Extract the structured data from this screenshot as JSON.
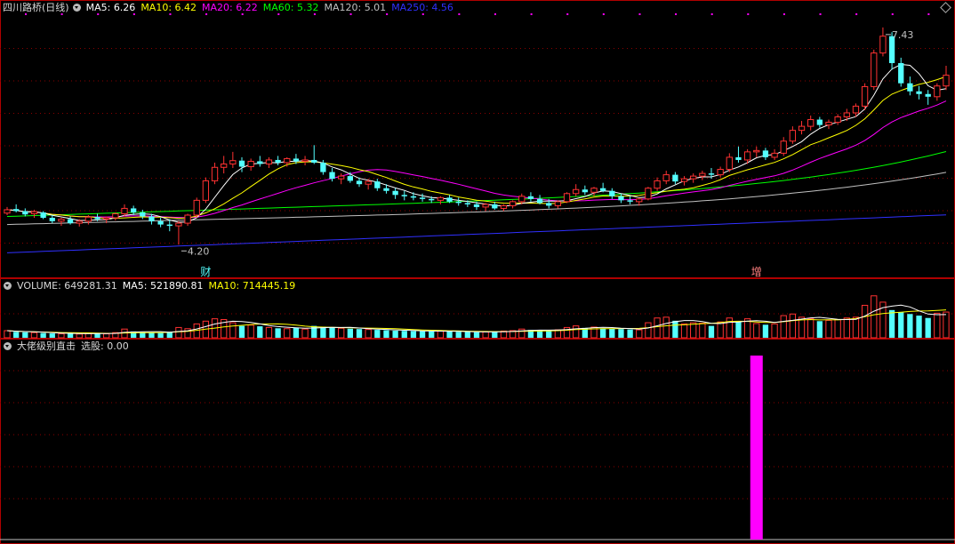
{
  "main": {
    "stock_name": "四川路桥(日线)",
    "ma_labels": [
      {
        "name": "MA5: ",
        "value": "6.26",
        "color": "#ffffff"
      },
      {
        "name": "MA10: ",
        "value": "6.42",
        "color": "#ffff00"
      },
      {
        "name": "MA20: ",
        "value": "6.22",
        "color": "#ff00ff"
      },
      {
        "name": "MA60: ",
        "value": "5.32",
        "color": "#00ff00"
      },
      {
        "name": "MA120: ",
        "value": "5.01",
        "color": "#c0c0c0"
      },
      {
        "name": "MA250: ",
        "value": "4.56",
        "color": "#3030ff"
      }
    ],
    "high_label": "7.43",
    "low_label": "4.20",
    "markers": [
      "财",
      "增"
    ]
  },
  "volume": {
    "title": "VOLUME: ",
    "volume_value": "649281.31",
    "ma5_label": "MA5: ",
    "ma5_value": "521890.81",
    "ma10_label": "MA10: ",
    "ma10_value": "714445.19"
  },
  "indicator": {
    "title": "大佬级别直击",
    "signal_label": "选股: ",
    "signal_value": "0.00"
  },
  "colors": {
    "up": "#ff3232",
    "down": "#54ffff",
    "grid": "#8b0000",
    "border": "#b00000",
    "signal": "#ff00ff",
    "ma5": "#ffffff",
    "ma10": "#ffff00",
    "ma20": "#ff00ff",
    "ma60": "#00ff00",
    "ma120": "#c0c0c0",
    "ma250": "#3030ff"
  },
  "chart_data": {
    "type": "candlestick",
    "price_range": [
      3.9,
      7.6
    ],
    "ohlc": [
      [
        4.67,
        4.76,
        4.64,
        4.72
      ],
      [
        4.73,
        4.8,
        4.68,
        4.7
      ],
      [
        4.7,
        4.74,
        4.62,
        4.65
      ],
      [
        4.66,
        4.72,
        4.6,
        4.69
      ],
      [
        4.68,
        4.7,
        4.58,
        4.6
      ],
      [
        4.6,
        4.64,
        4.52,
        4.55
      ],
      [
        4.55,
        4.6,
        4.48,
        4.58
      ],
      [
        4.58,
        4.62,
        4.5,
        4.52
      ],
      [
        4.52,
        4.58,
        4.47,
        4.55
      ],
      [
        4.55,
        4.64,
        4.5,
        4.61
      ],
      [
        4.61,
        4.66,
        4.55,
        4.58
      ],
      [
        4.58,
        4.62,
        4.52,
        4.6
      ],
      [
        4.6,
        4.68,
        4.56,
        4.66
      ],
      [
        4.66,
        4.8,
        4.62,
        4.74
      ],
      [
        4.74,
        4.78,
        4.64,
        4.68
      ],
      [
        4.68,
        4.72,
        4.58,
        4.62
      ],
      [
        4.62,
        4.66,
        4.5,
        4.55
      ],
      [
        4.55,
        4.6,
        4.46,
        4.5
      ],
      [
        4.5,
        4.58,
        4.4,
        4.48
      ],
      [
        4.48,
        4.55,
        4.2,
        4.52
      ],
      [
        4.52,
        4.66,
        4.48,
        4.64
      ],
      [
        4.64,
        4.9,
        4.6,
        4.86
      ],
      [
        4.86,
        5.2,
        4.82,
        5.15
      ],
      [
        5.15,
        5.42,
        5.1,
        5.35
      ],
      [
        5.35,
        5.52,
        5.26,
        5.4
      ],
      [
        5.4,
        5.58,
        5.34,
        5.45
      ],
      [
        5.45,
        5.5,
        5.28,
        5.36
      ],
      [
        5.36,
        5.48,
        5.3,
        5.44
      ],
      [
        5.44,
        5.52,
        5.36,
        5.4
      ],
      [
        5.4,
        5.5,
        5.34,
        5.46
      ],
      [
        5.46,
        5.52,
        5.38,
        5.42
      ],
      [
        5.42,
        5.5,
        5.36,
        5.48
      ],
      [
        5.48,
        5.55,
        5.4,
        5.44
      ],
      [
        5.44,
        5.52,
        5.38,
        5.46
      ],
      [
        5.46,
        5.68,
        5.4,
        5.42
      ],
      [
        5.42,
        5.46,
        5.24,
        5.28
      ],
      [
        5.28,
        5.34,
        5.14,
        5.18
      ],
      [
        5.18,
        5.26,
        5.1,
        5.22
      ],
      [
        5.22,
        5.28,
        5.12,
        5.15
      ],
      [
        5.15,
        5.2,
        5.06,
        5.1
      ],
      [
        5.1,
        5.18,
        5.02,
        5.14
      ],
      [
        5.14,
        5.18,
        5.0,
        5.04
      ],
      [
        5.04,
        5.1,
        4.96,
        5.0
      ],
      [
        5.0,
        5.04,
        4.88,
        4.94
      ],
      [
        4.94,
        5.0,
        4.86,
        4.92
      ],
      [
        4.92,
        4.98,
        4.86,
        4.9
      ],
      [
        4.9,
        4.96,
        4.84,
        4.88
      ],
      [
        4.88,
        4.92,
        4.82,
        4.86
      ],
      [
        4.86,
        4.92,
        4.8,
        4.9
      ],
      [
        4.9,
        4.94,
        4.82,
        4.84
      ],
      [
        4.84,
        4.9,
        4.78,
        4.82
      ],
      [
        4.82,
        4.86,
        4.76,
        4.8
      ],
      [
        4.8,
        4.84,
        4.72,
        4.76
      ],
      [
        4.76,
        4.82,
        4.7,
        4.8
      ],
      [
        4.8,
        4.84,
        4.72,
        4.74
      ],
      [
        4.74,
        4.8,
        4.7,
        4.78
      ],
      [
        4.78,
        4.86,
        4.74,
        4.84
      ],
      [
        4.84,
        4.96,
        4.8,
        4.92
      ],
      [
        4.92,
        4.98,
        4.84,
        4.88
      ],
      [
        4.88,
        4.94,
        4.8,
        4.82
      ],
      [
        4.82,
        4.88,
        4.74,
        4.78
      ],
      [
        4.78,
        4.86,
        4.74,
        4.84
      ],
      [
        4.84,
        4.98,
        4.82,
        4.96
      ],
      [
        4.96,
        5.1,
        4.92,
        5.02
      ],
      [
        5.02,
        5.08,
        4.94,
        4.98
      ],
      [
        4.98,
        5.06,
        4.92,
        5.04
      ],
      [
        5.04,
        5.12,
        4.98,
        5.0
      ],
      [
        5.0,
        5.04,
        4.88,
        4.92
      ],
      [
        4.92,
        4.96,
        4.82,
        4.86
      ],
      [
        4.86,
        4.92,
        4.8,
        4.84
      ],
      [
        4.84,
        4.9,
        4.78,
        4.88
      ],
      [
        4.88,
        5.06,
        4.86,
        5.04
      ],
      [
        5.04,
        5.2,
        5.0,
        5.15
      ],
      [
        5.15,
        5.3,
        5.1,
        5.24
      ],
      [
        5.24,
        5.28,
        5.1,
        5.14
      ],
      [
        5.14,
        5.22,
        5.08,
        5.18
      ],
      [
        5.18,
        5.26,
        5.12,
        5.22
      ],
      [
        5.22,
        5.3,
        5.16,
        5.26
      ],
      [
        5.26,
        5.34,
        5.18,
        5.24
      ],
      [
        5.24,
        5.36,
        5.2,
        5.32
      ],
      [
        5.32,
        5.56,
        5.28,
        5.5
      ],
      [
        5.5,
        5.66,
        5.42,
        5.46
      ],
      [
        5.46,
        5.62,
        5.4,
        5.58
      ],
      [
        5.58,
        5.66,
        5.5,
        5.6
      ],
      [
        5.6,
        5.64,
        5.46,
        5.5
      ],
      [
        5.5,
        5.62,
        5.46,
        5.56
      ],
      [
        5.56,
        5.8,
        5.52,
        5.74
      ],
      [
        5.74,
        5.96,
        5.7,
        5.9
      ],
      [
        5.9,
        6.04,
        5.84,
        5.96
      ],
      [
        5.96,
        6.12,
        5.9,
        6.06
      ],
      [
        6.06,
        6.1,
        5.94,
        5.98
      ],
      [
        5.98,
        6.06,
        5.92,
        6.02
      ],
      [
        6.02,
        6.14,
        5.98,
        6.1
      ],
      [
        6.1,
        6.22,
        6.04,
        6.16
      ],
      [
        6.16,
        6.3,
        6.1,
        6.26
      ],
      [
        6.26,
        6.6,
        6.2,
        6.55
      ],
      [
        6.55,
        7.1,
        6.5,
        7.05
      ],
      [
        7.05,
        7.43,
        7.0,
        7.3
      ],
      [
        7.3,
        7.36,
        6.8,
        6.9
      ],
      [
        6.9,
        6.98,
        6.55,
        6.6
      ],
      [
        6.6,
        6.7,
        6.42,
        6.48
      ],
      [
        6.48,
        6.56,
        6.36,
        6.44
      ],
      [
        6.44,
        6.5,
        6.28,
        6.4
      ],
      [
        6.4,
        6.6,
        6.34,
        6.56
      ],
      [
        6.56,
        6.86,
        6.5,
        6.72
      ]
    ],
    "volume_range": [
      0,
      1100000
    ],
    "volume": [
      180000,
      150000,
      140000,
      130000,
      120000,
      110000,
      100000,
      105000,
      95000,
      110000,
      120000,
      100000,
      130000,
      220000,
      160000,
      140000,
      130000,
      120000,
      150000,
      260000,
      230000,
      350000,
      420000,
      480000,
      460000,
      380000,
      300000,
      320000,
      290000,
      260000,
      240000,
      230000,
      250000,
      220000,
      300000,
      280000,
      260000,
      240000,
      230000,
      220000,
      210000,
      200000,
      190000,
      180000,
      175000,
      170000,
      165000,
      160000,
      170000,
      160000,
      150000,
      145000,
      140000,
      150000,
      160000,
      170000,
      180000,
      220000,
      200000,
      190000,
      180000,
      200000,
      260000,
      300000,
      250000,
      270000,
      240000,
      230000,
      220000,
      210000,
      200000,
      380000,
      500000,
      520000,
      430000,
      350000,
      380000,
      370000,
      300000,
      400000,
      500000,
      420000,
      480000,
      360000,
      330000,
      350000,
      560000,
      600000,
      520000,
      480000,
      420000,
      440000,
      460000,
      500000,
      520000,
      820000,
      1060000,
      900000,
      700000,
      640000,
      600000,
      560000,
      500000,
      620000,
      650000
    ],
    "signal": {
      "index": 83,
      "value": 1
    }
  }
}
